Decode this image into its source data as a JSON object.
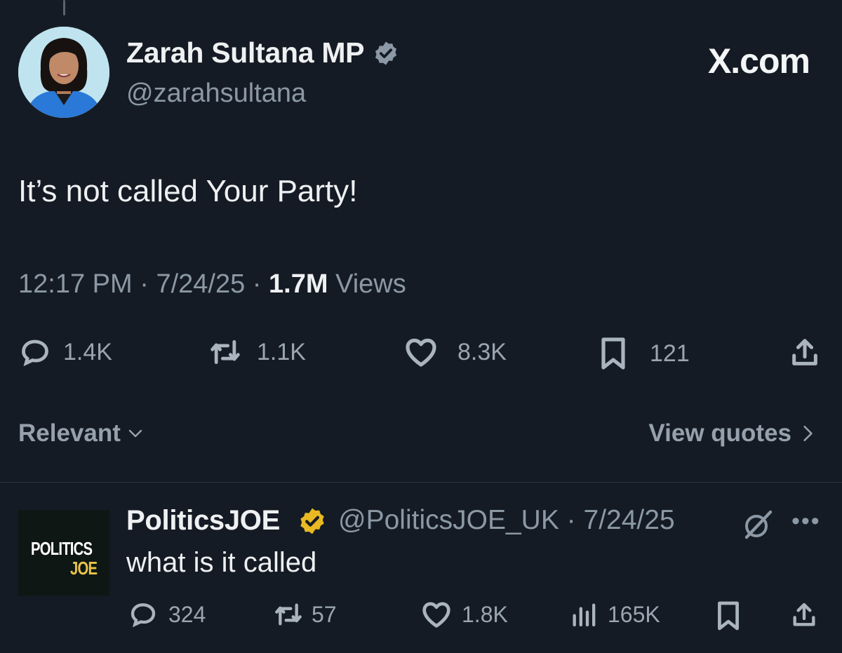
{
  "brand": {
    "site_label": "X.com"
  },
  "main_tweet": {
    "author_name": "Zarah Sultana MP",
    "author_handle": "@zarahsultana",
    "verified_color": "#8b98a5",
    "text": "It’s not called Your Party!",
    "time": "12:17 PM",
    "date": "7/24/25",
    "views_count": "1.7M",
    "views_label": "Views",
    "actions": {
      "replies": "1.4K",
      "reposts": "1.1K",
      "likes": "8.3K",
      "bookmarks": "121"
    }
  },
  "sort": {
    "label": "Relevant",
    "view_quotes_label": "View quotes"
  },
  "reply": {
    "author_name": "PoliticsJOE",
    "author_handle": "@PoliticsJOE_UK",
    "date": "7/24/25",
    "logo_line1": "POLITICS",
    "logo_line2": "JOE",
    "verified_color": "#e8b923",
    "text": "what is it called",
    "actions": {
      "replies": "324",
      "reposts": "57",
      "likes": "1.8K",
      "views": "165K"
    }
  }
}
